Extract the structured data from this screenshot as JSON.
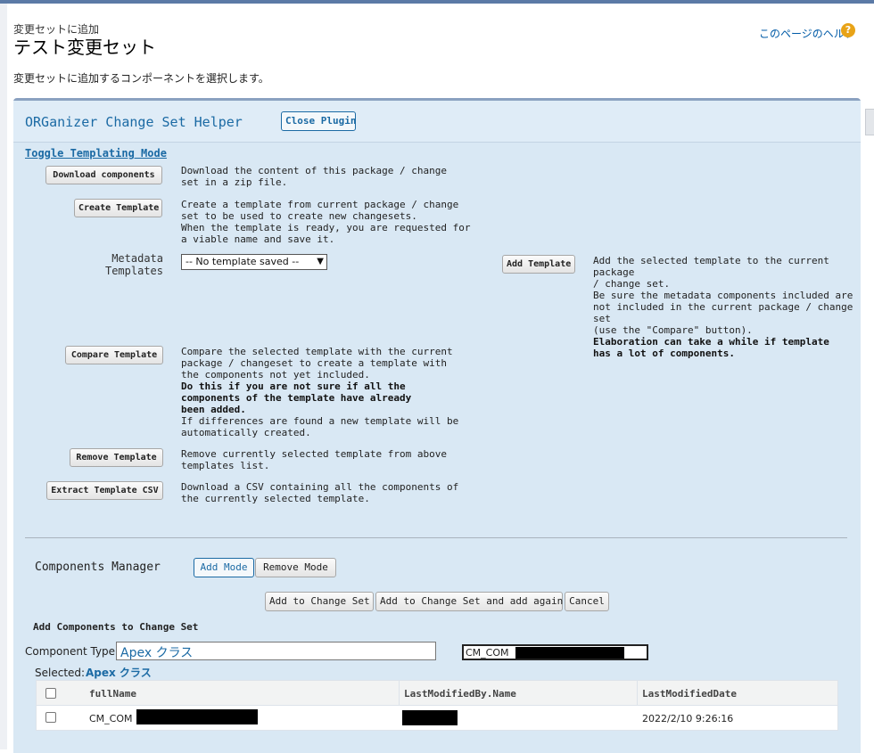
{
  "header": {
    "breadcrumb": "変更セットに追加",
    "title": "テスト変更セット",
    "help_link": "このページのヘルプ",
    "description": "変更セットに追加するコンポーネントを選択します。"
  },
  "plugin": {
    "title": "ORGanizer Change Set Helper",
    "close_button": "Close Plugin",
    "toggle_link": "Toggle Templating Mode",
    "download_button": "Download components",
    "download_desc": [
      "Download the content of this package / change",
      "set in a zip file."
    ],
    "create_button": "Create Template",
    "create_desc": [
      "Create a template from current package / change",
      "set to be used to create new changesets.",
      "When the template is ready, you are requested for",
      "a viable name and save it."
    ],
    "metadata_label": "Metadata Templates",
    "template_select": "-- No template saved --",
    "add_template_button": "Add Template",
    "add_desc": [
      "Add the selected template to the current package",
      "/ change set.",
      "Be sure the metadata components included are",
      "not included in the current package / change set",
      "(use the \"Compare\" button)."
    ],
    "add_desc_bold": [
      "Elaboration can take a while if template",
      "has a lot of components."
    ],
    "compare_button": "Compare Template",
    "compare_desc": [
      "Compare the selected template with the current",
      "package / changeset to create a template with",
      "the components not yet included."
    ],
    "compare_desc_bold": [
      "Do this if you are not sure if all the",
      "components of the template have already",
      "been added."
    ],
    "compare_desc_after": [
      "If differences are found a new template will be",
      "automatically created."
    ],
    "remove_button": "Remove Template",
    "remove_desc": [
      "Remove currently selected template from above",
      "templates list."
    ],
    "extract_button": "Extract Template CSV",
    "extract_desc": [
      "Download a CSV containing all the components of",
      "the currently selected template."
    ]
  },
  "manager": {
    "title": "Components Manager",
    "add_mode": "Add Mode",
    "remove_mode": "Remove Mode",
    "add_to_change_set": "Add to Change Set",
    "add_and_again": "Add to Change Set and add again",
    "cancel": "Cancel",
    "subhead": "Add Components to Change Set",
    "component_type_label": "Component Type:",
    "component_type_value": "Apex クラス",
    "filter_value": "CM_COM",
    "selected_label": "Selected:",
    "selected_value": "Apex クラス",
    "columns": [
      "fullName",
      "LastModifiedBy.Name",
      "LastModifiedDate"
    ],
    "rows": [
      {
        "fullName": "CM_COM",
        "lastModifiedBy": "",
        "lastModifiedDate": "2022/2/10 9:26:16"
      }
    ]
  },
  "colors": {
    "accent": "#1b6aa4",
    "panel_bg": "#d9e8f4",
    "help_icon": "#e8a317"
  },
  "icons": {
    "help": "help-question-icon"
  }
}
